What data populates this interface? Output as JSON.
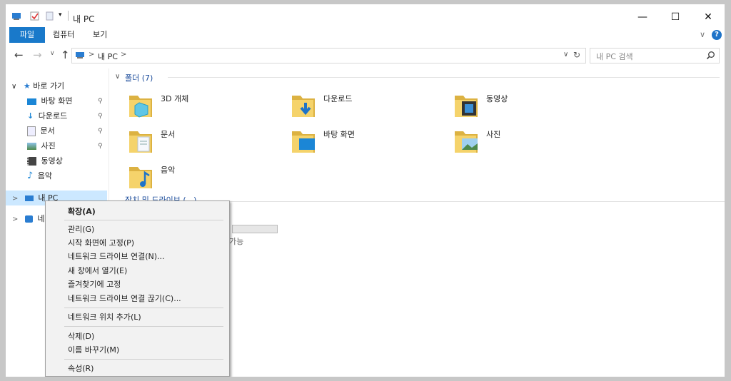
{
  "window": {
    "title": "내 PC",
    "minimize_glyph": "—",
    "maximize_glyph": "☐",
    "close_glyph": "✕"
  },
  "ribbon": {
    "tabs": [
      "파일",
      "컴퓨터",
      "보기"
    ],
    "expand_glyph": "∨",
    "help_glyph": "?"
  },
  "address": {
    "back_glyph": "←",
    "forward_glyph": "→",
    "recent_glyph": "∨",
    "up_glyph": "↑",
    "path_separator": ">",
    "path": "내 PC",
    "end_chevron": ">",
    "dropdown_glyph": "∨",
    "refresh_glyph": "↻"
  },
  "search": {
    "placeholder": "내 PC 검색"
  },
  "sidebar": {
    "quick_access": "바로 가기",
    "quick_items": [
      {
        "label": "바탕 화면",
        "icon": "desktop-icon",
        "pinned": true
      },
      {
        "label": "다운로드",
        "icon": "download-icon",
        "pinned": true
      },
      {
        "label": "문서",
        "icon": "document-icon",
        "pinned": true
      },
      {
        "label": "사진",
        "icon": "picture-icon",
        "pinned": true
      },
      {
        "label": "동영상",
        "icon": "video-icon",
        "pinned": false
      },
      {
        "label": "음악",
        "icon": "music-icon",
        "pinned": false
      }
    ],
    "this_pc": "내 PC",
    "network": "네",
    "expand_glyph": ">",
    "collapse_glyph": "∨",
    "pin_glyph": "📌"
  },
  "main": {
    "folders_header": "폴더 (7)",
    "folders": [
      {
        "label": "3D 개체",
        "icon": "3d-objects-icon"
      },
      {
        "label": "다운로드",
        "icon": "downloads-folder-icon"
      },
      {
        "label": "동영상",
        "icon": "videos-folder-icon"
      },
      {
        "label": "문서",
        "icon": "documents-folder-icon"
      },
      {
        "label": "바탕 화면",
        "icon": "desktop-folder-icon"
      },
      {
        "label": "사진",
        "icon": "pictures-folder-icon"
      },
      {
        "label": "음악",
        "icon": "music-folder-icon"
      }
    ],
    "drives_header_partial": "장치 및 드라이브 (...)",
    "drive_free_partial": "가능"
  },
  "context_menu": {
    "groups": [
      [
        {
          "label": "확장(A)",
          "bold": true
        }
      ],
      [
        {
          "label": "관리(G)"
        },
        {
          "label": "시작 화면에 고정(P)"
        },
        {
          "label": "네트워크 드라이브 연결(N)..."
        },
        {
          "label": "새 창에서 열기(E)"
        },
        {
          "label": "즐겨찾기에 고정"
        },
        {
          "label": "네트워크 드라이브 연결 끊기(C)..."
        }
      ],
      [
        {
          "label": "네트워크 위치 추가(L)"
        }
      ],
      [
        {
          "label": "삭제(D)"
        },
        {
          "label": "이름 바꾸기(M)"
        }
      ],
      [
        {
          "label": "속성(R)"
        }
      ]
    ]
  },
  "colors": {
    "accent": "#1979ca",
    "folder_yellow": "#f5d36b",
    "folder_dark": "#dcb242",
    "selection": "#cce8ff",
    "help": "#1e73c8"
  }
}
